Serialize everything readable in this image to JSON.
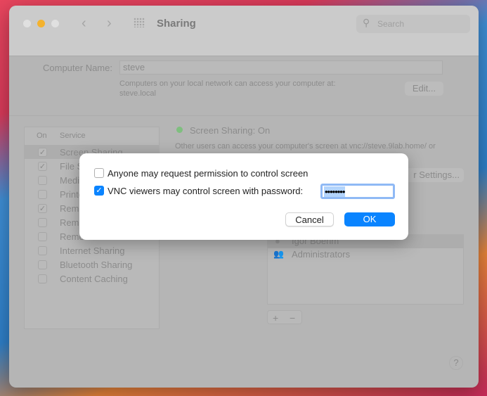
{
  "window": {
    "title": "Sharing",
    "search_placeholder": "Search"
  },
  "computer_name": {
    "label": "Computer Name:",
    "value": "steve",
    "note_line1": "Computers on your local network can access your computer at:",
    "note_line2": "steve.local",
    "edit_label": "Edit..."
  },
  "services": {
    "col_on": "On",
    "col_service": "Service",
    "items": [
      {
        "label": "Screen Sharing",
        "on": true
      },
      {
        "label": "File S",
        "on": true
      },
      {
        "label": "Medi",
        "on": false
      },
      {
        "label": "Printe",
        "on": false
      },
      {
        "label": "Remo",
        "on": true
      },
      {
        "label": "Remo",
        "on": false
      },
      {
        "label": "Remo",
        "on": false
      },
      {
        "label": "Internet Sharing",
        "on": false
      },
      {
        "label": "Bluetooth Sharing",
        "on": false
      },
      {
        "label": "Content Caching",
        "on": false
      }
    ]
  },
  "status": {
    "title": "Screen Sharing: On",
    "desc": "Other users can access your computer's screen at vnc://steve.9lab.home/ or",
    "settings_label": "r Settings...",
    "status_color": "#7fbf7f"
  },
  "users": [
    "Igor Boehm",
    "Administrators"
  ],
  "add_label": "+",
  "remove_label": "−",
  "help_label": "?",
  "dialog": {
    "option1": "Anyone may request permission to control screen",
    "option1_checked": false,
    "option2": "VNC viewers may control screen with password:",
    "option2_checked": true,
    "password": "••••••••",
    "cancel_label": "Cancel",
    "ok_label": "OK",
    "accent": "#0a84ff"
  }
}
